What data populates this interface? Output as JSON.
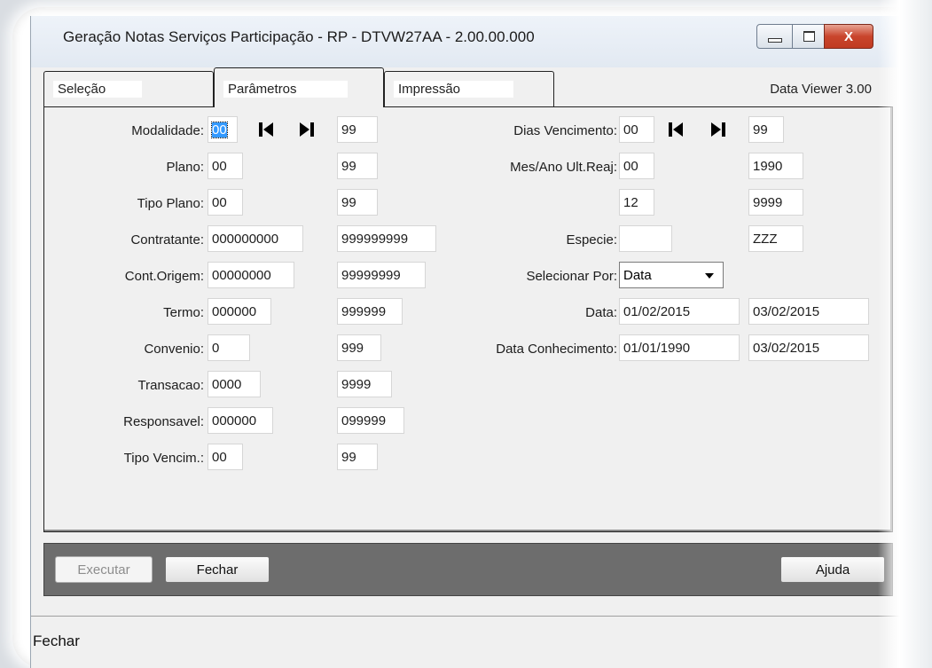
{
  "window": {
    "title": "Geração Notas Serviços Participação - RP - DTVW27AA - 2.00.00.000",
    "close_glyph": "X"
  },
  "tabs": [
    {
      "label": "Seleção"
    },
    {
      "label": "Parâmetros"
    },
    {
      "label": "Impressão"
    }
  ],
  "viewer_label": "Data Viewer 3.00",
  "left_fields": [
    {
      "label": "Modalidade:",
      "from": "00",
      "to": "99"
    },
    {
      "label": "Plano:",
      "from": "00",
      "to": "99"
    },
    {
      "label": "Tipo Plano:",
      "from": "00",
      "to": "99"
    },
    {
      "label": "Contratante:",
      "from": "000000000",
      "to": "999999999"
    },
    {
      "label": "Cont.Origem:",
      "from": "00000000",
      "to": "99999999"
    },
    {
      "label": "Termo:",
      "from": "000000",
      "to": "999999"
    },
    {
      "label": "Convenio:",
      "from": "0",
      "to": "999"
    },
    {
      "label": "Transacao:",
      "from": "0000",
      "to": "9999"
    },
    {
      "label": "Responsavel:",
      "from": "000000",
      "to": "099999"
    },
    {
      "label": "Tipo Vencim.:",
      "from": "00",
      "to": "99"
    }
  ],
  "right_fields": {
    "dias_vencimento": {
      "label": "Dias Vencimento:",
      "from": "00",
      "to": "99"
    },
    "mes_ano": {
      "label": "Mes/Ano Ult.Reaj:",
      "from_mes": "00",
      "from_ano": "1990",
      "to_mes": "12",
      "to_ano": "9999"
    },
    "especie": {
      "label": "Especie:",
      "from": "",
      "to": "ZZZ"
    },
    "selecionar_por": {
      "label": "Selecionar Por:",
      "value": "Data"
    },
    "data": {
      "label": "Data:",
      "from": "01/02/2015",
      "to": "03/02/2015"
    },
    "data_conhecimento": {
      "label": "Data Conhecimento:",
      "from": "01/01/1990",
      "to": "03/02/2015"
    }
  },
  "buttons": {
    "executar": "Executar",
    "fechar": "Fechar",
    "ajuda": "Ajuda"
  },
  "status": "Fechar"
}
